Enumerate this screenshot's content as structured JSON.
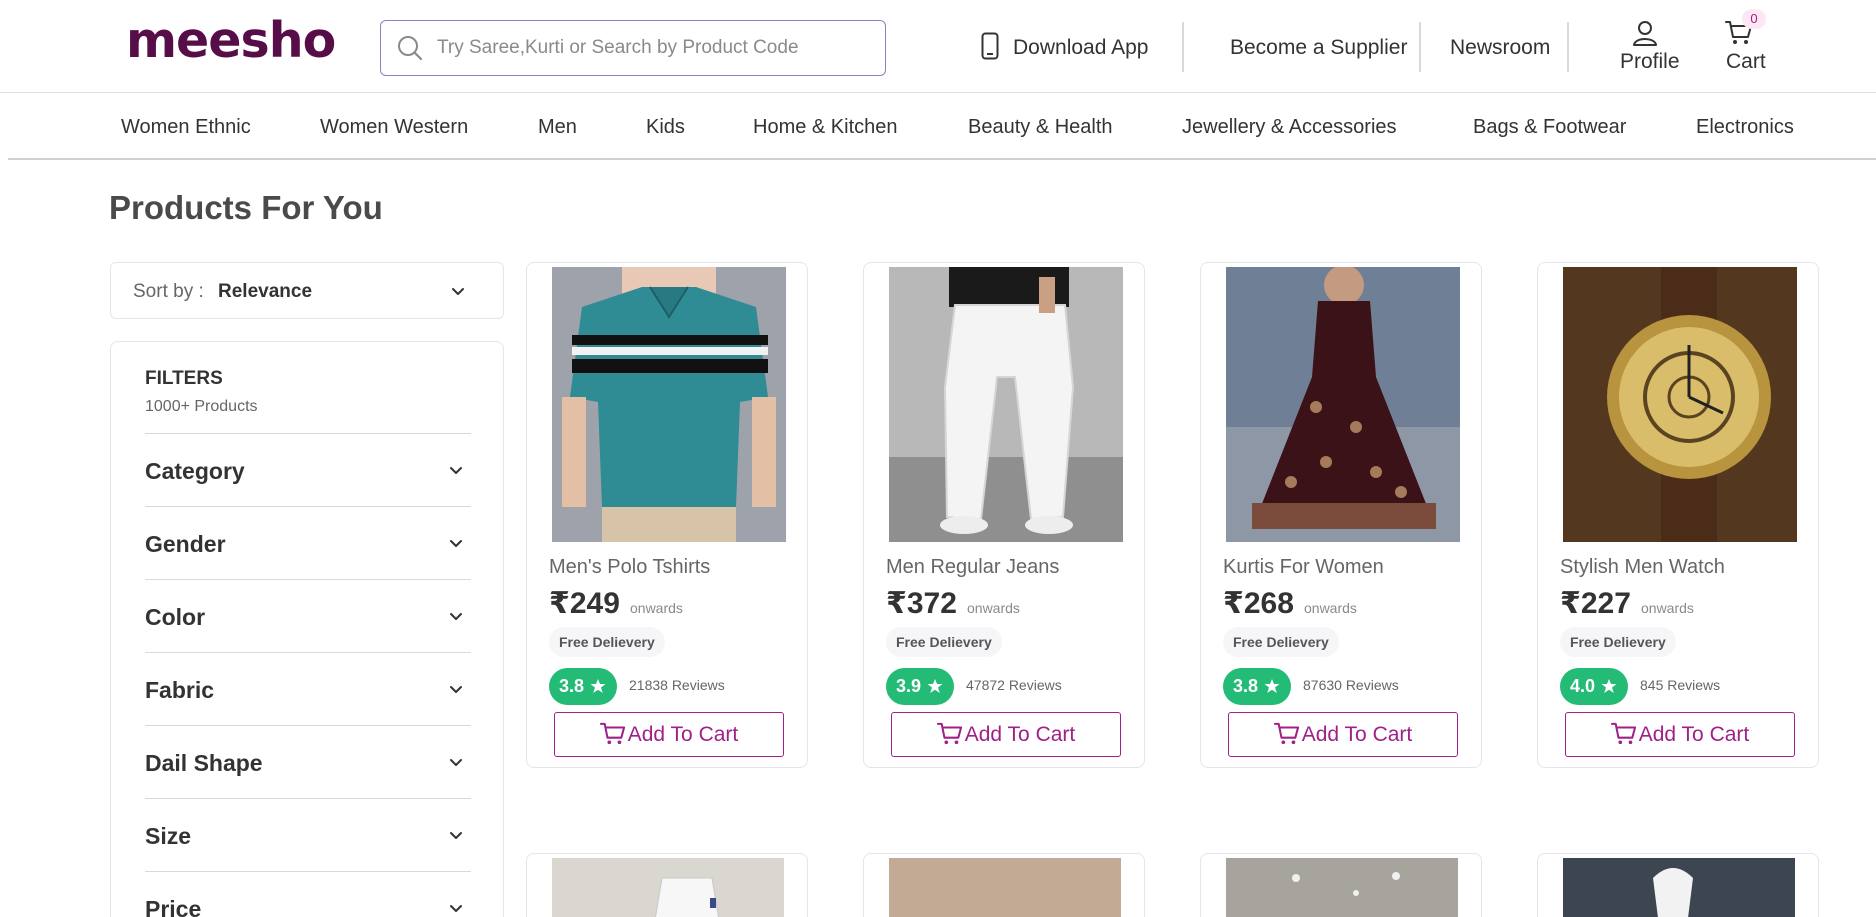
{
  "header": {
    "logo": "meesho",
    "search_placeholder": "Try Saree,Kurti or Search by Product Code",
    "download_app": "Download App",
    "become_supplier": "Become a Supplier",
    "newsroom": "Newsroom",
    "profile": "Profile",
    "cart": "Cart",
    "cart_count": "0"
  },
  "categories": [
    "Women Ethnic",
    "Women Western",
    "Men",
    "Kids",
    "Home & Kitchen",
    "Beauty & Health",
    "Jewellery & Accessories",
    "Bags & Footwear",
    "Electronics"
  ],
  "page_title": "Products For You",
  "sort": {
    "label": "Sort by :",
    "value": "Relevance"
  },
  "filters": {
    "title": "FILTERS",
    "count": "1000+ Products",
    "items": [
      "Category",
      "Gender",
      "Color",
      "Fabric",
      "Dail Shape",
      "Size",
      "Price"
    ]
  },
  "products": [
    {
      "name": "Men's Polo Tshirts",
      "price": "₹249",
      "onwards": "onwards",
      "delivery": "Free Delievery",
      "rating": "3.8",
      "reviews": "21838 Reviews",
      "add_to_cart": "Add To Cart"
    },
    {
      "name": "Men Regular Jeans",
      "price": "₹372",
      "onwards": "onwards",
      "delivery": "Free Delievery",
      "rating": "3.9",
      "reviews": "47872 Reviews",
      "add_to_cart": "Add To Cart"
    },
    {
      "name": "Kurtis For Women",
      "price": "₹268",
      "onwards": "onwards",
      "delivery": "Free Delievery",
      "rating": "3.8",
      "reviews": "87630 Reviews",
      "add_to_cart": "Add To Cart"
    },
    {
      "name": "Stylish Men Watch",
      "price": "₹227",
      "onwards": "onwards",
      "delivery": "Free Delievery",
      "rating": "4.0",
      "reviews": "845 Reviews",
      "add_to_cart": "Add To Cart"
    }
  ],
  "colors": {
    "brand": "#570d48",
    "accent": "#9f2089",
    "rating_green": "#23bb75",
    "search_border": "#8b80c4"
  },
  "icons": [
    "search-icon",
    "mobile-phone-icon",
    "user-icon",
    "cart-icon",
    "chevron-down-icon",
    "star-icon"
  ]
}
